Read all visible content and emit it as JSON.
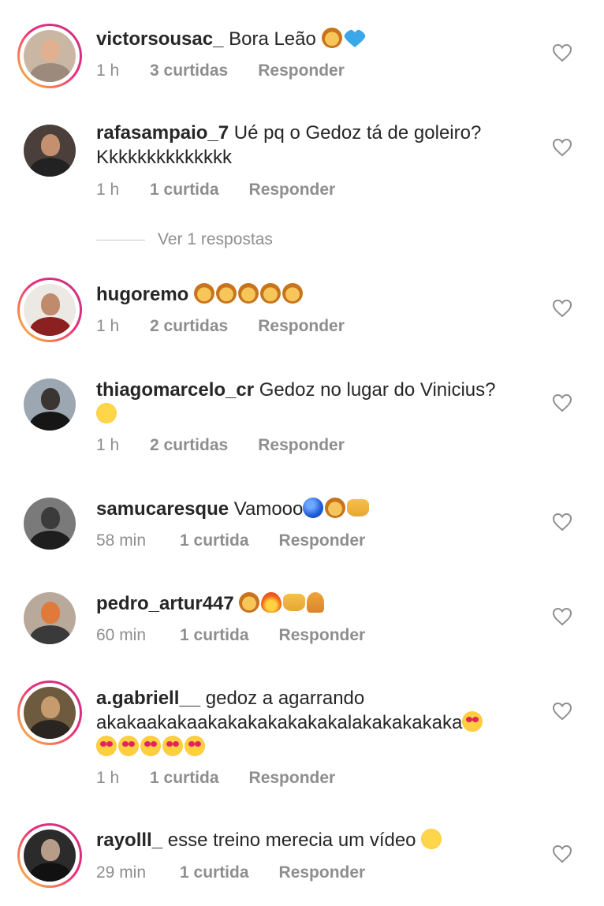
{
  "comments": [
    {
      "username": "victorsousac_",
      "text": "Bora Leão",
      "emojis": [
        "lion",
        "blue-heart"
      ],
      "time": "1 h",
      "likes": "3 curtidas",
      "reply": "Responder",
      "story": true
    },
    {
      "username": "rafasampaio_7",
      "text": "Ué pq o Gedoz tá de goleiro? Kkkkkkkkkkkkkk",
      "emojis": [],
      "time": "1 h",
      "likes": "1 curtida",
      "reply": "Responder",
      "story": false
    },
    {
      "username": "hugoremo",
      "text": "",
      "emojis": [
        "lion",
        "lion",
        "lion",
        "lion",
        "lion"
      ],
      "time": "1 h",
      "likes": "2 curtidas",
      "reply": "Responder",
      "story": true
    },
    {
      "username": "thiagomarcelo_cr",
      "text": "Gedoz no lugar do Vinicius?",
      "emojis": [
        "flushed-face"
      ],
      "time": "1 h",
      "likes": "2 curtidas",
      "reply": "Responder",
      "story": false
    },
    {
      "username": "samucaresque",
      "text": "Vamooo",
      "emojis": [
        "blue-circle",
        "lion",
        "raising-hands"
      ],
      "time": "58 min",
      "likes": "1 curtida",
      "reply": "Responder",
      "story": false
    },
    {
      "username": "pedro_artur447",
      "text": "",
      "emojis": [
        "lion",
        "fire",
        "raising-hands",
        "folded-hands"
      ],
      "time": "60 min",
      "likes": "1 curtida",
      "reply": "Responder",
      "story": false
    },
    {
      "username": "a.gabriell__",
      "text": "gedoz a agarrando akakaakakaakakakakakakakalakakakakaka",
      "emojis": [
        "heart-eyes",
        "heart-eyes",
        "heart-eyes",
        "heart-eyes",
        "heart-eyes",
        "heart-eyes"
      ],
      "time": "1 h",
      "likes": "1 curtida",
      "reply": "Responder",
      "story": true
    },
    {
      "username": "rayolll_",
      "text": "esse treino merecia um vídeo",
      "emojis": [
        "rofl"
      ],
      "time": "29 min",
      "likes": "1 curtida",
      "reply": "Responder",
      "story": true
    }
  ],
  "view_replies": "Ver 1 respostas",
  "colors": {
    "text": "#262626",
    "secondary": "#8e8e8e",
    "story_gradient_start": "#f9ce34",
    "story_gradient_end": "#c13584"
  }
}
